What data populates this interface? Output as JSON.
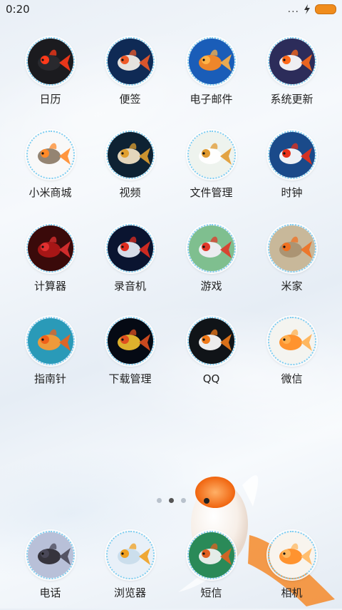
{
  "status_bar": {
    "time": "0:20",
    "more_dots": "..."
  },
  "apps": [
    {
      "label": "日历",
      "icon": "goldfish-black-icon"
    },
    {
      "label": "便签",
      "icon": "goldfish-white-spotted-icon"
    },
    {
      "label": "电子邮件",
      "icon": "goldfish-pair-icon"
    },
    {
      "label": "系统更新",
      "icon": "goldfish-fantail-icon"
    },
    {
      "label": "小米商城",
      "icon": "cat-goldfish-icon"
    },
    {
      "label": "视频",
      "icon": "goldfish-veil-icon"
    },
    {
      "label": "文件管理",
      "icon": "goldfish-white-icon"
    },
    {
      "label": "时钟",
      "icon": "goldfish-red-cap-icon"
    },
    {
      "label": "计算器",
      "icon": "goldfish-school-icon"
    },
    {
      "label": "录音机",
      "icon": "goldfish-oranda-icon"
    },
    {
      "label": "游戏",
      "icon": "goldfish-pearl-icon"
    },
    {
      "label": "米家",
      "icon": "goldfish-bowl-icon"
    },
    {
      "label": "指南针",
      "icon": "goldfish-coral-icon"
    },
    {
      "label": "下载管理",
      "icon": "goldfish-aquarium-icon"
    },
    {
      "label": "QQ",
      "icon": "goldfish-orange-white-icon"
    },
    {
      "label": "微信",
      "icon": "goldfish-orange-icon"
    }
  ],
  "dock": [
    {
      "label": "电话",
      "icon": "goldfish-dark-icon"
    },
    {
      "label": "浏览器",
      "icon": "fish-tank-icon"
    },
    {
      "label": "短信",
      "icon": "goldfish-green-icon"
    },
    {
      "label": "相机",
      "icon": "goldfish-swimming-icon"
    }
  ],
  "pager": {
    "pages": 3,
    "active_index": 1
  },
  "colors": {
    "icon_ring": "#7ccdf0",
    "battery": "#f08c1c",
    "text": "#222222"
  }
}
